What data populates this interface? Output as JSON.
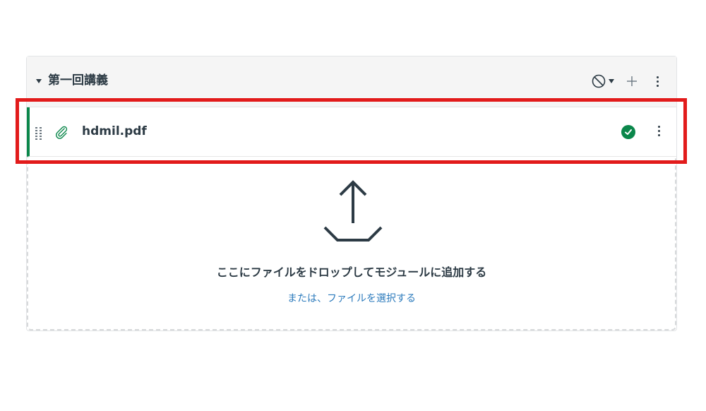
{
  "module": {
    "title": "第一回講義",
    "icons": {
      "collapse": "caret-down-icon",
      "publish": "unpublished-circle-icon",
      "add": "plus-icon",
      "menu": "kebab-icon"
    }
  },
  "item": {
    "name": "hdmil.pdf",
    "type_icon": "paperclip-icon",
    "status_icon": "published-check-icon",
    "accent_color": "#0b874b"
  },
  "dropzone": {
    "message": "ここにファイルをドロップしてモジュールに追加する",
    "select_link": "または、ファイルを選択する",
    "icon": "upload-icon"
  },
  "annotation": {
    "highlight_color": "#e21b1b"
  }
}
